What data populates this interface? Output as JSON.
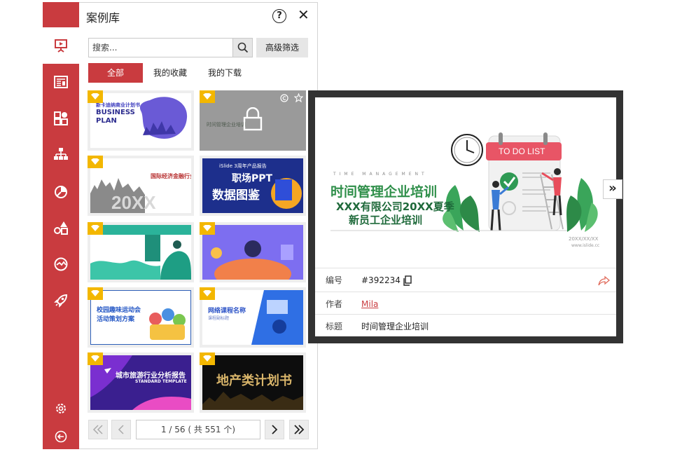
{
  "panel": {
    "title": "案例库",
    "help_label": "?",
    "close_label": "✕",
    "search": {
      "placeholder": "搜索...",
      "value": ""
    },
    "advanced_filter": "高级筛选",
    "tabs": [
      {
        "label": "全部",
        "active": true
      },
      {
        "label": "我的收藏",
        "active": false
      },
      {
        "label": "我的下载",
        "active": false
      }
    ],
    "thumbnails": [
      {
        "title_line1": "新卡迪纳商业计划书",
        "title_line2": "BUSINESS",
        "title_line3": "PLAN",
        "locked": false
      },
      {
        "title_line1": "时间管理企业培训",
        "locked": true
      },
      {
        "title_line1": "国际经济金融行业",
        "title_line2": "20XX",
        "locked": false
      },
      {
        "title_line1": "iSlide 3周年产品报告",
        "title_line2": "职场PPT",
        "title_line3": "数据图鉴",
        "locked": false
      },
      {
        "title_line1": "",
        "locked": false
      },
      {
        "title_line1": "",
        "locked": false
      },
      {
        "title_line1": "校园趣味运动会",
        "title_line2": "活动策划方案",
        "locked": false
      },
      {
        "title_line1": "网络课程名称",
        "title_line2": "课程副标题",
        "locked": false
      },
      {
        "title_line1": "城市旅游行业分析报告",
        "title_line2": "STANDARD TEMPLATE",
        "locked": false
      },
      {
        "title_line1": "地产类计划书",
        "locked": false
      }
    ],
    "pager": {
      "page_info": "1  / 56 ( 共 551 个)"
    }
  },
  "rail_icons": [
    "presentation-icon",
    "layout-icon",
    "shapes-icon",
    "diagram-icon",
    "chart-icon",
    "icons-library-icon",
    "image-icon",
    "rocket-icon",
    "settings-icon",
    "back-icon"
  ],
  "preview": {
    "slide": {
      "small_caps": "TIME MANAGEMENT",
      "title": "时间管理企业培训",
      "line2": "XXX有限公司20XX夏季",
      "line3": "新员工企业培训",
      "todo_label": "TO DO LIST",
      "footer_date": "20XX/XX/XX",
      "footer_site": "www.islide.cc"
    },
    "next_label": "»",
    "rows": [
      {
        "label": "编号",
        "value": "#392234"
      },
      {
        "label": "作者",
        "value": "Mila"
      },
      {
        "label": "标题",
        "value": "时间管理企业培训"
      }
    ]
  },
  "colors": {
    "accent": "#c93b3f",
    "green": "#2f8f4a",
    "blue": "#1d2f8c",
    "popup_bg": "#333333"
  }
}
